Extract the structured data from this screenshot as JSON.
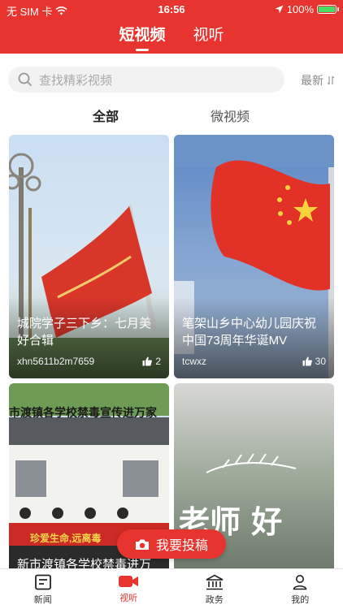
{
  "status_bar": {
    "carrier": "无 SIM 卡",
    "time": "16:56",
    "battery": "100%"
  },
  "header": {
    "tabs": [
      {
        "label": "短视频",
        "active": true
      },
      {
        "label": "视听",
        "active": false
      }
    ]
  },
  "search": {
    "placeholder": "查找精彩视频",
    "sort_label": "最新"
  },
  "subtabs": [
    {
      "label": "全部",
      "active": true
    },
    {
      "label": "微视频",
      "active": false
    }
  ],
  "cards": [
    {
      "title": "城院学子三下乡：七月美好合辑",
      "author": "xhn5611b2m7659",
      "likes": "2",
      "banner": "",
      "caption": ""
    },
    {
      "title": "笔架山乡中心幼儿园庆祝中国73周年华诞MV",
      "author": "tcwxz",
      "likes": "30",
      "banner": "",
      "caption": ""
    },
    {
      "title": "新市渡镇各学校禁毒进万",
      "author": "",
      "likes": "",
      "banner": "市渡镇各学校禁毒宣传进万家",
      "caption": "珍爱生命,远离毒"
    },
    {
      "title": "",
      "author": "",
      "likes": "",
      "banner": "",
      "caption": "老师 好"
    }
  ],
  "fab": {
    "label": "我要投稿"
  },
  "bottom_nav": [
    {
      "label": "新闻",
      "icon": "news-icon",
      "active": false
    },
    {
      "label": "视听",
      "icon": "video-camera-icon",
      "active": true
    },
    {
      "label": "政务",
      "icon": "government-building-icon",
      "active": false
    },
    {
      "label": "我的",
      "icon": "user-icon",
      "active": false
    }
  ],
  "colors": {
    "brand_red": "#e8342f",
    "battery_green": "#4cd964"
  }
}
